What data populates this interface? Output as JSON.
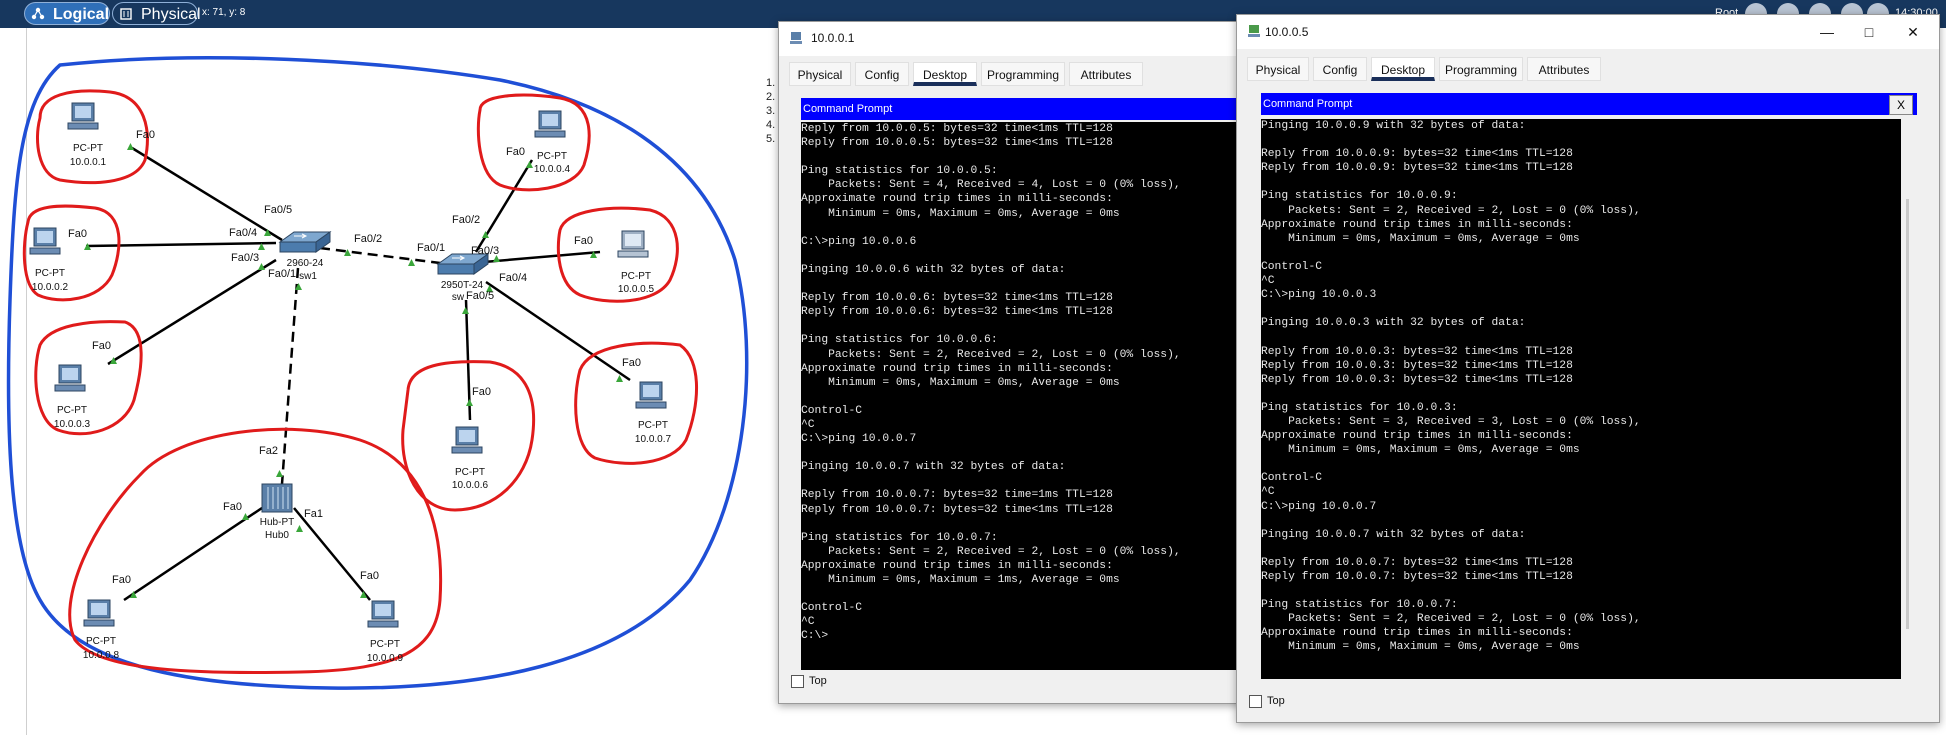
{
  "toolbar": {
    "logical_label": "Logical",
    "physical_label": "Physical",
    "coords": "x: 71, y: 8",
    "root_label": "Root",
    "clock": "14:30:00"
  },
  "background_list": [
    "1.",
    "2.",
    "3.",
    "4.",
    "5."
  ],
  "topology": {
    "pcs": [
      {
        "type": "PC-PT",
        "ip": "10.0.0.1"
      },
      {
        "type": "PC-PT",
        "ip": "10.0.0.2"
      },
      {
        "type": "PC-PT",
        "ip": "10.0.0.3"
      },
      {
        "type": "PC-PT",
        "ip": "10.0.0.4"
      },
      {
        "type": "PC-PT",
        "ip": "10.0.0.5"
      },
      {
        "type": "PC-PT",
        "ip": "10.0.0.6"
      },
      {
        "type": "PC-PT",
        "ip": "10.0.0.7"
      },
      {
        "type": "PC-PT",
        "ip": "10.0.0.8"
      },
      {
        "type": "PC-PT",
        "ip": "10.0.0.9"
      }
    ],
    "switch1": {
      "model": "2960-24",
      "name": "sw1"
    },
    "switch2": {
      "model": "2950T-24",
      "name": "sw"
    },
    "hub": {
      "model": "Hub-PT",
      "name": "Hub0"
    },
    "ports": {
      "fa0": "Fa0",
      "fa0_1": "Fa0/1",
      "fa0_2": "Fa0/2",
      "fa0_3": "Fa0/3",
      "fa0_4": "Fa0/4",
      "fa0_5": "Fa0/5",
      "fa1": "Fa1",
      "fa2": "Fa2"
    },
    "colors": {
      "pc_circle": "#e01b1b",
      "network_outline": "#1f4fd6",
      "link_up": "#3aa63a"
    }
  },
  "window1": {
    "title": "10.0.0.1",
    "tabs": [
      "Physical",
      "Config",
      "Desktop",
      "Programming",
      "Attributes"
    ],
    "active_tab": "Desktop",
    "cmd_header": "Command Prompt",
    "top_label": "Top",
    "console_lines": [
      "Reply from 10.0.0.5: bytes=32 time<1ms TTL=128",
      "Reply from 10.0.0.5: bytes=32 time<1ms TTL=128",
      "",
      "Ping statistics for 10.0.0.5:",
      "    Packets: Sent = 4, Received = 4, Lost = 0 (0% loss),",
      "Approximate round trip times in milli-seconds:",
      "    Minimum = 0ms, Maximum = 0ms, Average = 0ms",
      "",
      "C:\\>ping 10.0.0.6",
      "",
      "Pinging 10.0.0.6 with 32 bytes of data:",
      "",
      "Reply from 10.0.0.6: bytes=32 time<1ms TTL=128",
      "Reply from 10.0.0.6: bytes=32 time<1ms TTL=128",
      "",
      "Ping statistics for 10.0.0.6:",
      "    Packets: Sent = 2, Received = 2, Lost = 0 (0% loss),",
      "Approximate round trip times in milli-seconds:",
      "    Minimum = 0ms, Maximum = 0ms, Average = 0ms",
      "",
      "Control-C",
      "^C",
      "C:\\>ping 10.0.0.7",
      "",
      "Pinging 10.0.0.7 with 32 bytes of data:",
      "",
      "Reply from 10.0.0.7: bytes=32 time=1ms TTL=128",
      "Reply from 10.0.0.7: bytes=32 time<1ms TTL=128",
      "",
      "Ping statistics for 10.0.0.7:",
      "    Packets: Sent = 2, Received = 2, Lost = 0 (0% loss),",
      "Approximate round trip times in milli-seconds:",
      "    Minimum = 0ms, Maximum = 1ms, Average = 0ms",
      "",
      "Control-C",
      "^C",
      "C:\\>"
    ]
  },
  "window2": {
    "title": "10.0.0.5",
    "tabs": [
      "Physical",
      "Config",
      "Desktop",
      "Programming",
      "Attributes"
    ],
    "active_tab": "Desktop",
    "cmd_header": "Command Prompt",
    "close_label": "X",
    "top_label": "Top",
    "console_lines": [
      "Pinging 10.0.0.9 with 32 bytes of data:",
      "",
      "Reply from 10.0.0.9: bytes=32 time<1ms TTL=128",
      "Reply from 10.0.0.9: bytes=32 time<1ms TTL=128",
      "",
      "Ping statistics for 10.0.0.9:",
      "    Packets: Sent = 2, Received = 2, Lost = 0 (0% loss),",
      "Approximate round trip times in milli-seconds:",
      "    Minimum = 0ms, Maximum = 0ms, Average = 0ms",
      "",
      "Control-C",
      "^C",
      "C:\\>ping 10.0.0.3",
      "",
      "Pinging 10.0.0.3 with 32 bytes of data:",
      "",
      "Reply from 10.0.0.3: bytes=32 time<1ms TTL=128",
      "Reply from 10.0.0.3: bytes=32 time<1ms TTL=128",
      "Reply from 10.0.0.3: bytes=32 time<1ms TTL=128",
      "",
      "Ping statistics for 10.0.0.3:",
      "    Packets: Sent = 3, Received = 3, Lost = 0 (0% loss),",
      "Approximate round trip times in milli-seconds:",
      "    Minimum = 0ms, Maximum = 0ms, Average = 0ms",
      "",
      "Control-C",
      "^C",
      "C:\\>ping 10.0.0.7",
      "",
      "Pinging 10.0.0.7 with 32 bytes of data:",
      "",
      "Reply from 10.0.0.7: bytes=32 time<1ms TTL=128",
      "Reply from 10.0.0.7: bytes=32 time<1ms TTL=128",
      "",
      "Ping statistics for 10.0.0.7:",
      "    Packets: Sent = 2, Received = 2, Lost = 0 (0% loss),",
      "Approximate round trip times in milli-seconds:",
      "    Minimum = 0ms, Maximum = 0ms, Average = 0ms"
    ]
  }
}
